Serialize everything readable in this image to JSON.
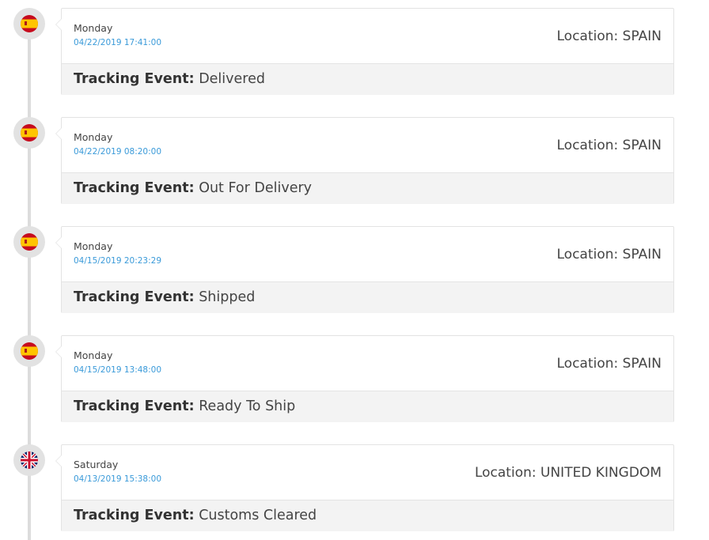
{
  "colors": {
    "timeline_line": "#dcdcdc",
    "badge_bg": "#e2e2e2",
    "timestamp_blue": "#3a9ad9",
    "text_dark": "#444444",
    "card_footer_bg": "#f3f3f3"
  },
  "labels": {
    "location_prefix": "Location: ",
    "tracking_event": "Tracking Event:"
  },
  "events": [
    {
      "flag_icon": "spain-flag-icon",
      "day": "Monday",
      "timestamp": "04/22/2019 17:41:00",
      "location": "SPAIN",
      "status": "Delivered"
    },
    {
      "flag_icon": "spain-flag-icon",
      "day": "Monday",
      "timestamp": "04/22/2019 08:20:00",
      "location": "SPAIN",
      "status": "Out For Delivery"
    },
    {
      "flag_icon": "spain-flag-icon",
      "day": "Monday",
      "timestamp": "04/15/2019 20:23:29",
      "location": "SPAIN",
      "status": "Shipped"
    },
    {
      "flag_icon": "spain-flag-icon",
      "day": "Monday",
      "timestamp": "04/15/2019 13:48:00",
      "location": "SPAIN",
      "status": "Ready To Ship"
    },
    {
      "flag_icon": "uk-flag-icon",
      "day": "Saturday",
      "timestamp": "04/13/2019 15:38:00",
      "location": "UNITED KINGDOM",
      "status": "Customs Cleared"
    }
  ]
}
